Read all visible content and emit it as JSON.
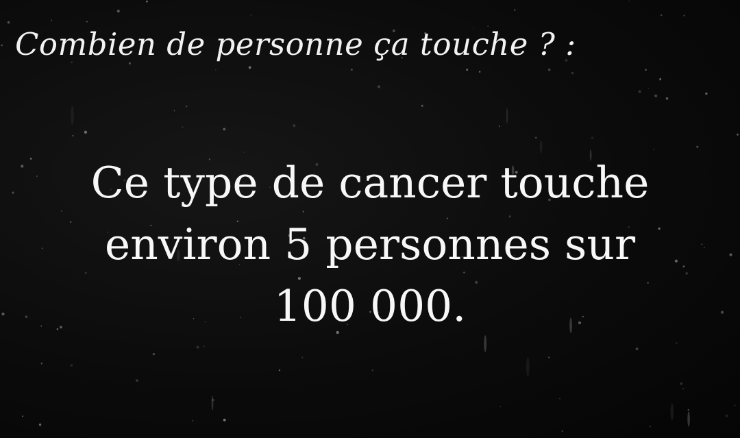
{
  "question": "Combien de personne ça touche ? :",
  "answer_lines": [
    "Ce type de cancer touche",
    "environ 5 personnes sur",
    "100 000."
  ],
  "colors": {
    "background": "#0a0a0a",
    "text": "#f5f5f5"
  }
}
